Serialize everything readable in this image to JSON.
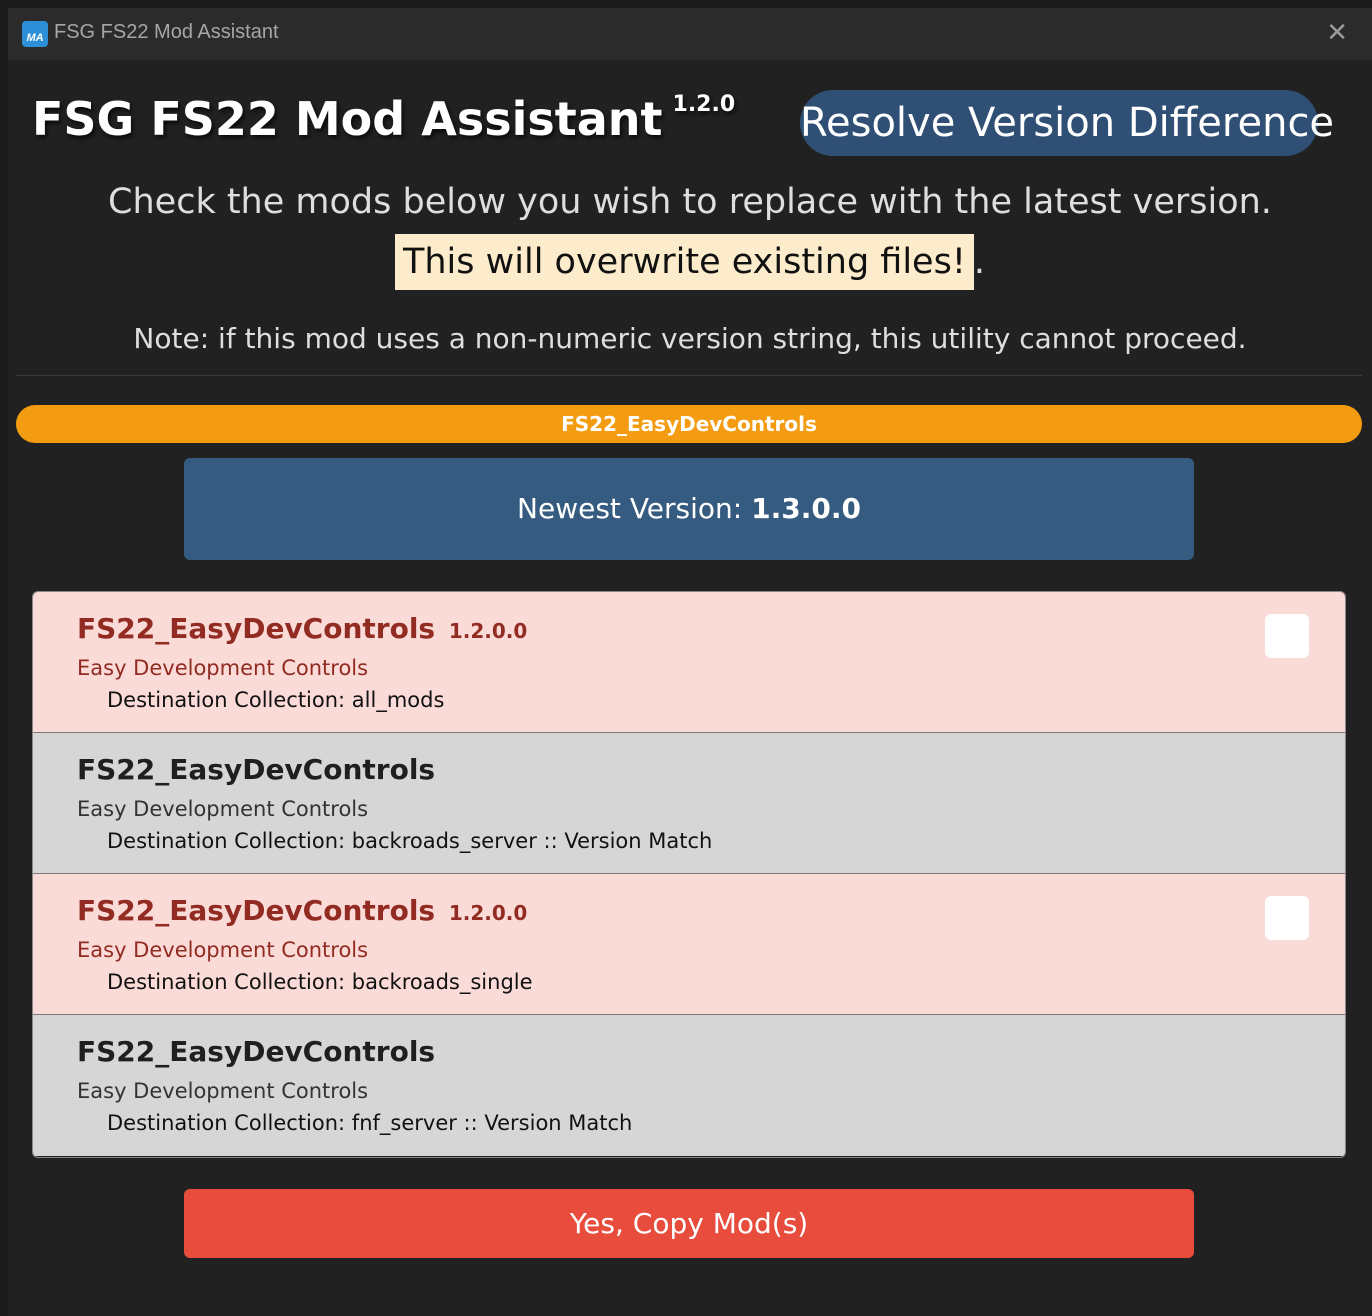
{
  "window": {
    "icon_text": "MA",
    "title": "FSG FS22 Mod Assistant",
    "close_glyph": "✕"
  },
  "header": {
    "app_title": "FSG FS22 Mod Assistant",
    "app_version": "1.2.0",
    "page_title": "Resolve Version Difference"
  },
  "instructions": {
    "line1": "Check the mods below you wish to replace with the latest version.",
    "warning": "This will overwrite existing files!",
    "warning_suffix": ".",
    "note": "Note: if this mod uses a non-numeric version string, this utility cannot proceed."
  },
  "mod": {
    "name": "FS22_EasyDevControls",
    "newest_label": "Newest Version: ",
    "newest_version": "1.3.0.0"
  },
  "collections": [
    {
      "name": "FS22_EasyDevControls",
      "version": "1.2.0.0",
      "description": "Easy Development Controls",
      "destination": "Destination Collection: all_mods",
      "status": "old"
    },
    {
      "name": "FS22_EasyDevControls",
      "version": "",
      "description": "Easy Development Controls",
      "destination": "Destination Collection: backroads_server :: Version Match",
      "status": "match"
    },
    {
      "name": "FS22_EasyDevControls",
      "version": "1.2.0.0",
      "description": "Easy Development Controls",
      "destination": "Destination Collection: backroads_single",
      "status": "old"
    },
    {
      "name": "FS22_EasyDevControls",
      "version": "",
      "description": "Easy Development Controls",
      "destination": "Destination Collection: fnf_server :: Version Match",
      "status": "match"
    }
  ],
  "actions": {
    "copy_label": "Yes, Copy Mod(s)"
  },
  "colors": {
    "mod_pill": "#f39c12",
    "newest_box": "#365b80",
    "page_title_pill": "#2f5074",
    "old_row": "#fadbd8",
    "match_row": "#d6d6d6",
    "copy_button": "#e74c3c",
    "warning_highlight": "#fdeccb"
  }
}
